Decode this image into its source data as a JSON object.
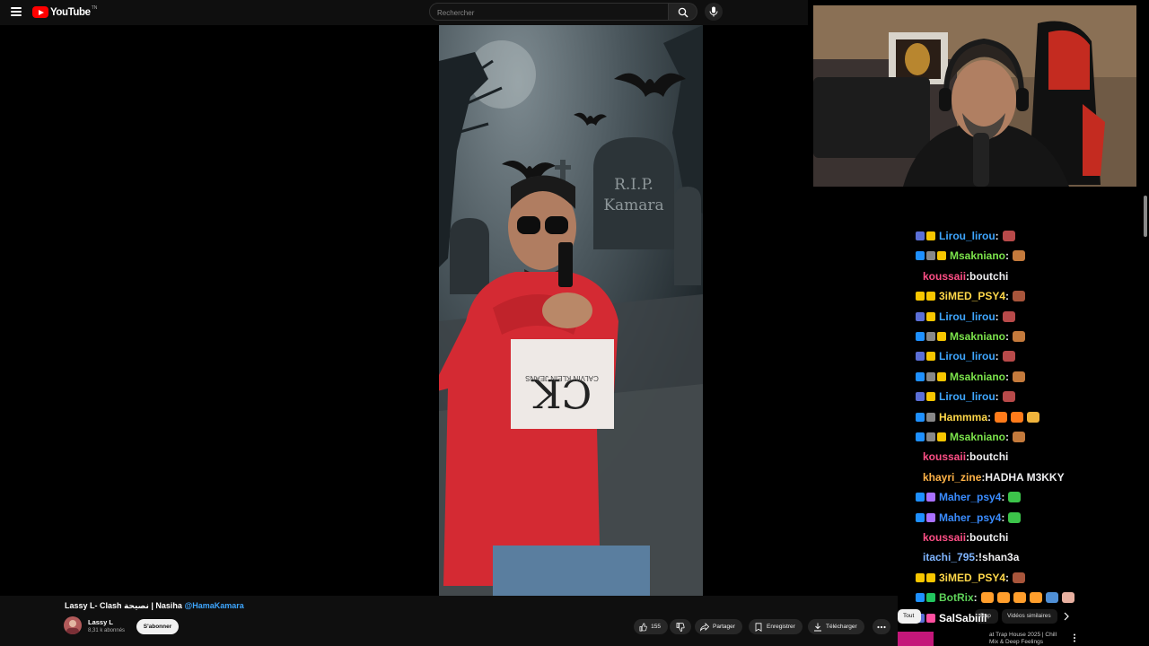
{
  "header": {
    "logo_text": "YouTube",
    "logo_region": "TN",
    "search_placeholder": "Rechercher"
  },
  "video": {
    "title_prefix": "Lassy L- Clash نصيحة | Nasiha ",
    "title_mention": "@HamaKamara",
    "tombstone_line1": "R.I.P.",
    "tombstone_line2": "Kamara",
    "hoodie_text": "CALVIN KLEIN JEANS"
  },
  "channel": {
    "name": "Lassy L",
    "subscribers": "8,31 k abonnés",
    "subscribe_label": "S'abonner"
  },
  "actions": {
    "like_count": "155",
    "share_label": "Partager",
    "save_label": "Enregistrer",
    "download_label": "Télécharger"
  },
  "chips": {
    "all": "Tout",
    "rap": "Rap",
    "similar": "Vidéos similaires"
  },
  "recommended": {
    "title_line1": "at Trap House 2025 | Chill",
    "title_line2": "Mix & Deep Feelings"
  },
  "chat": {
    "messages": [
      {
        "user": "Lirou_lirou",
        "color": "#3ea6ff",
        "text": "",
        "badges": [
          "#5b6fd6",
          "#f7c600"
        ],
        "emotes": [
          "#b84a4a"
        ]
      },
      {
        "user": "Msakniano",
        "color": "#7be34b",
        "text": "",
        "badges": [
          "#1e90ff",
          "#888888",
          "#f7c600"
        ],
        "emotes": [
          "#c47a3c"
        ]
      },
      {
        "user": "koussaii",
        "color": "#ff4f86",
        "text": "boutchi",
        "badges": [],
        "emotes": []
      },
      {
        "user": "3iMED_PSY4",
        "color": "#ffd84a",
        "text": "",
        "badges": [
          "#f7c600",
          "#f7c600"
        ],
        "emotes": [
          "#a8553b"
        ]
      },
      {
        "user": "Lirou_lirou",
        "color": "#3ea6ff",
        "text": "",
        "badges": [
          "#5b6fd6",
          "#f7c600"
        ],
        "emotes": [
          "#b84a4a"
        ]
      },
      {
        "user": "Msakniano",
        "color": "#7be34b",
        "text": "",
        "badges": [
          "#1e90ff",
          "#888888",
          "#f7c600"
        ],
        "emotes": [
          "#c47a3c"
        ]
      },
      {
        "user": "Lirou_lirou",
        "color": "#3ea6ff",
        "text": "",
        "badges": [
          "#5b6fd6",
          "#f7c600"
        ],
        "emotes": [
          "#b84a4a"
        ]
      },
      {
        "user": "Msakniano",
        "color": "#7be34b",
        "text": "",
        "badges": [
          "#1e90ff",
          "#888888",
          "#f7c600"
        ],
        "emotes": [
          "#c47a3c"
        ]
      },
      {
        "user": "Lirou_lirou",
        "color": "#3ea6ff",
        "text": "",
        "badges": [
          "#5b6fd6",
          "#f7c600"
        ],
        "emotes": [
          "#b84a4a"
        ]
      },
      {
        "user": "Hammma",
        "color": "#ffd84a",
        "text": "",
        "badges": [
          "#1e90ff",
          "#888888"
        ],
        "emotes": [
          "#ff7b1a",
          "#ff7b1a",
          "#f0b43c"
        ]
      },
      {
        "user": "Msakniano",
        "color": "#7be34b",
        "text": "",
        "badges": [
          "#1e90ff",
          "#888888",
          "#f7c600"
        ],
        "emotes": [
          "#c47a3c"
        ]
      },
      {
        "user": "koussaii",
        "color": "#ff4f86",
        "text": "boutchi",
        "badges": [],
        "emotes": []
      },
      {
        "user": "khayri_zine",
        "color": "#ffb347",
        "text": "HADHA M3KKY",
        "badges": [],
        "emotes": []
      },
      {
        "user": "Maher_psy4",
        "color": "#3a8cff",
        "text": "",
        "badges": [
          "#1e90ff",
          "#a970ff"
        ],
        "emotes": [
          "#3cc44a"
        ]
      },
      {
        "user": "Maher_psy4",
        "color": "#3a8cff",
        "text": "",
        "badges": [
          "#1e90ff",
          "#a970ff"
        ],
        "emotes": [
          "#3cc44a"
        ]
      },
      {
        "user": "koussaii",
        "color": "#ff4f86",
        "text": "boutchi",
        "badges": [],
        "emotes": []
      },
      {
        "user": "itachi_795",
        "color": "#7fb5ff",
        "text": "!shan3a",
        "badges": [],
        "emotes": []
      },
      {
        "user": "3iMED_PSY4",
        "color": "#ffd84a",
        "text": "",
        "badges": [
          "#f7c600",
          "#f7c600"
        ],
        "emotes": [
          "#a8553b"
        ]
      },
      {
        "user": "BotRix",
        "color": "#5fd35a",
        "text": "",
        "badges": [
          "#1e90ff",
          "#22c55e"
        ],
        "emotes": [
          "#ff9e2c",
          "#ff9e2c",
          "#ff9e2c",
          "#ff9e2c",
          "#4f8fd6",
          "#e8b0a0"
        ]
      },
      {
        "user": "SalSabiiil",
        "color": "#ffffff",
        "text": "",
        "badges": [
          "#5b6fd6",
          "#ff4fa0"
        ],
        "emotes": []
      }
    ]
  }
}
